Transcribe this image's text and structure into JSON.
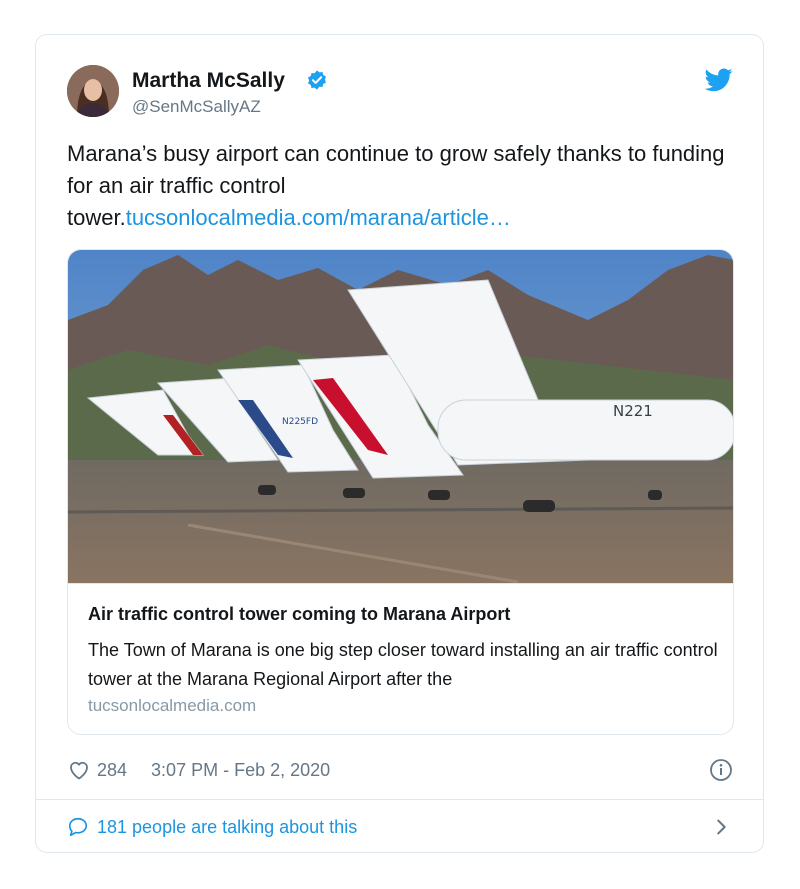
{
  "author": {
    "name": "Martha McSally",
    "handle": "@SenMcSallyAZ"
  },
  "tweet": {
    "text_before": "Marana’s busy airport can continue to grow safely thanks to funding for an air traffic control tower.",
    "link_text": "tucsonlocalmedia.com/marana/article…"
  },
  "card": {
    "title": "Air traffic control tower coming to Marana Airport",
    "description": "The Town of Marana is one big step closer toward installing an air traffic control tower at the Marana Regional Airport after the",
    "domain": "tucsonlocalmedia.com",
    "tail_numbers": [
      "N225FD",
      "N221"
    ]
  },
  "meta": {
    "likes": "284",
    "timestamp": "3:07 PM - Feb 2, 2020"
  },
  "footer": {
    "talking": "181 people are talking about this"
  },
  "colors": {
    "link": "#1b95e0",
    "secondary_text": "#657786",
    "border": "#e1e8ed",
    "verified": "#1da1f2"
  },
  "icons": [
    "verified-badge-icon",
    "twitter-bird-icon",
    "heart-icon",
    "info-icon",
    "comment-bubble-icon",
    "chevron-right-icon"
  ]
}
